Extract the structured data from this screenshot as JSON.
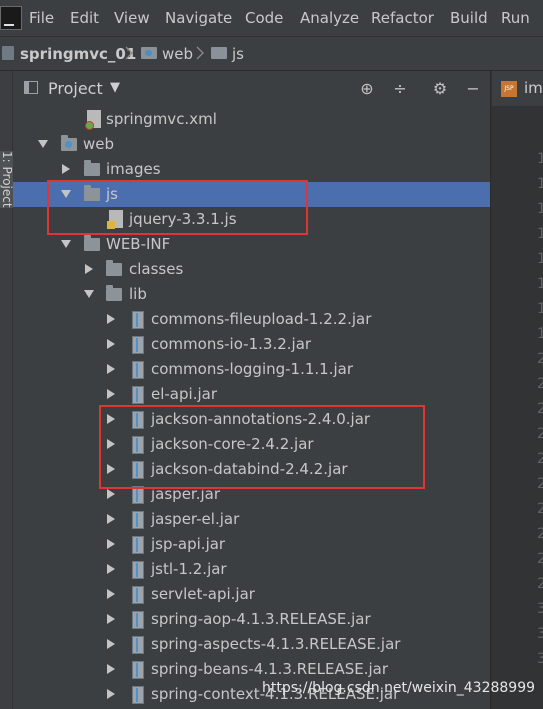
{
  "menubar": {
    "items": [
      "File",
      "Edit",
      "View",
      "Navigate",
      "Code",
      "Analyze",
      "Refactor",
      "Build",
      "Run"
    ]
  },
  "navbar": {
    "project": "springmvc_01",
    "folder1": "web",
    "folder2": "js"
  },
  "toolstrip": {
    "label": "1: Project"
  },
  "project_panel": {
    "title": "Project",
    "tools": [
      "locate-icon",
      "collapse-icon",
      "gear-icon",
      "hide-icon"
    ]
  },
  "editor": {
    "tab_label": "im",
    "tab_icon_text": "JSP"
  },
  "tree": [
    {
      "label": "springmvc.xml",
      "icon": "xml-file-icon"
    },
    {
      "label": "web",
      "icon": "web-folder-icon",
      "expanded": true
    },
    {
      "label": "images",
      "icon": "folder-icon",
      "expanded": false
    },
    {
      "label": "js",
      "icon": "folder-icon",
      "expanded": true,
      "selected": true
    },
    {
      "label": "jquery-3.3.1.js",
      "icon": "js-file-icon"
    },
    {
      "label": "WEB-INF",
      "icon": "folder-icon",
      "expanded": true
    },
    {
      "label": "classes",
      "icon": "folder-icon",
      "expanded": false
    },
    {
      "label": "lib",
      "icon": "folder-icon",
      "expanded": true
    },
    {
      "label": "commons-fileupload-1.2.2.jar",
      "icon": "jar-icon"
    },
    {
      "label": "commons-io-1.3.2.jar",
      "icon": "jar-icon"
    },
    {
      "label": "commons-logging-1.1.1.jar",
      "icon": "jar-icon"
    },
    {
      "label": "el-api.jar",
      "icon": "jar-icon"
    },
    {
      "label": "jackson-annotations-2.4.0.jar",
      "icon": "jar-icon"
    },
    {
      "label": "jackson-core-2.4.2.jar",
      "icon": "jar-icon"
    },
    {
      "label": "jackson-databind-2.4.2.jar",
      "icon": "jar-icon"
    },
    {
      "label": "jasper.jar",
      "icon": "jar-icon"
    },
    {
      "label": "jasper-el.jar",
      "icon": "jar-icon"
    },
    {
      "label": "jsp-api.jar",
      "icon": "jar-icon"
    },
    {
      "label": "jstl-1.2.jar",
      "icon": "jar-icon"
    },
    {
      "label": "servlet-api.jar",
      "icon": "jar-icon"
    },
    {
      "label": "spring-aop-4.1.3.RELEASE.jar",
      "icon": "jar-icon"
    },
    {
      "label": "spring-aspects-4.1.3.RELEASE.jar",
      "icon": "jar-icon"
    },
    {
      "label": "spring-beans-4.1.3.RELEASE.jar",
      "icon": "jar-icon"
    },
    {
      "label": "spring-context-4.1.3.RELEASE.jar",
      "icon": "jar-icon"
    }
  ],
  "watermark": "https://blog.csdn.net/weixin_43288999",
  "colors": {
    "selection": "#4b6eaf",
    "highlight_box": "#e03535",
    "panel": "#3c3f41"
  }
}
